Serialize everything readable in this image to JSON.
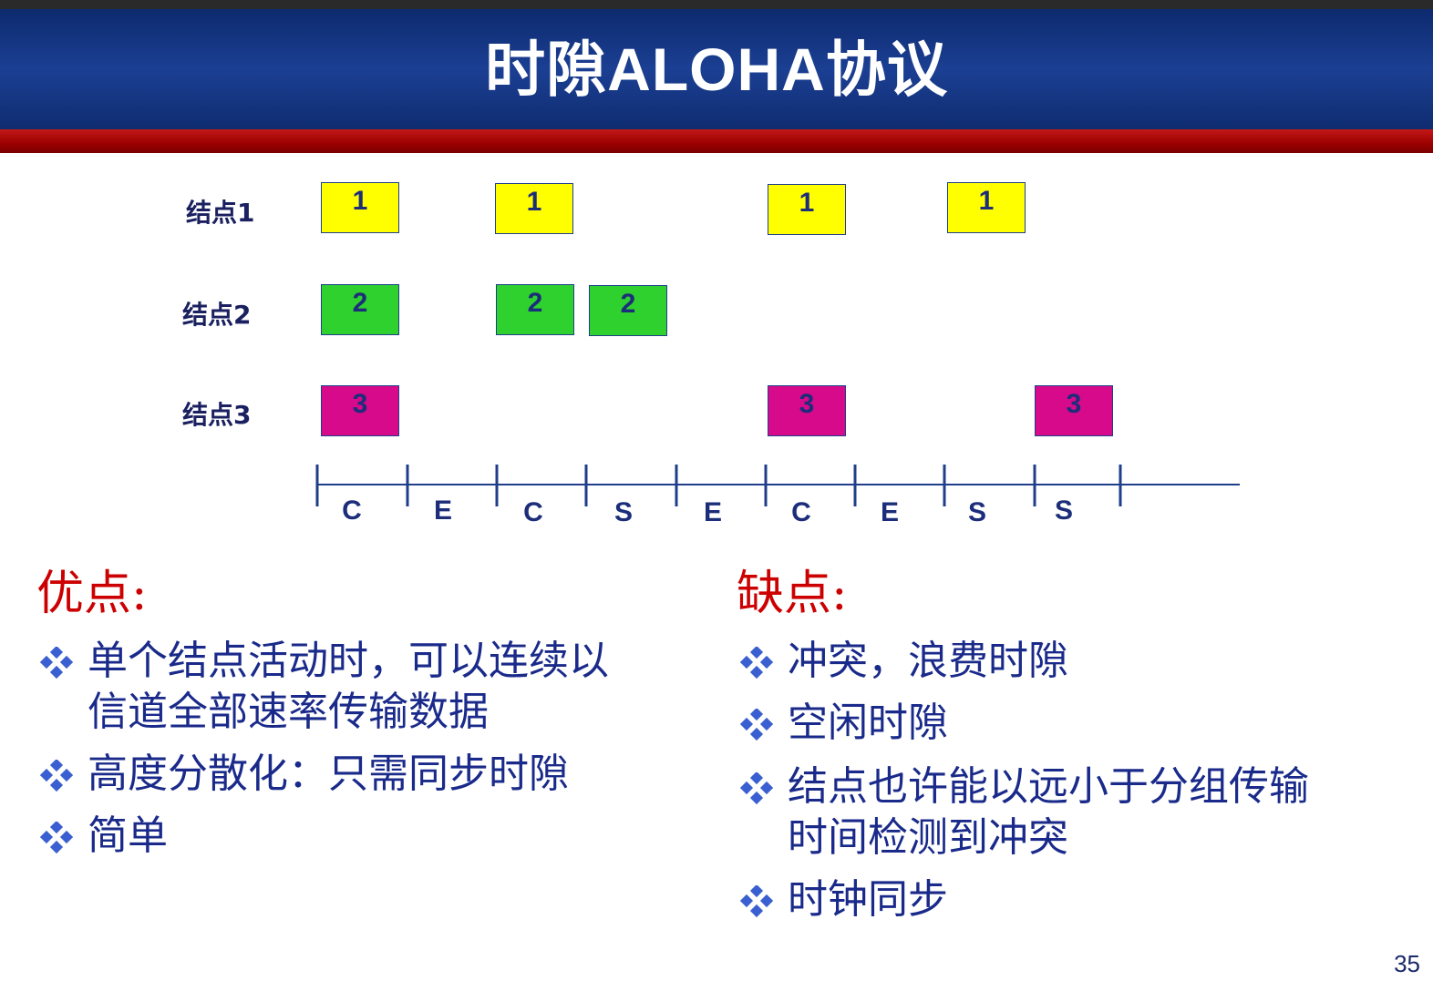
{
  "title": "时隙ALOHA协议",
  "nodes": [
    {
      "label": "结点1",
      "slots": [
        "1",
        "1",
        "1",
        "1"
      ]
    },
    {
      "label": "结点2",
      "slots": [
        "2",
        "2",
        "2"
      ]
    },
    {
      "label": "结点3",
      "slots": [
        "3",
        "3",
        "3"
      ]
    }
  ],
  "timeline": [
    "C",
    "E",
    "C",
    "S",
    "E",
    "C",
    "E",
    "S",
    "S"
  ],
  "pros": {
    "heading": "优点:",
    "items": [
      [
        "单个结点活动时，可以连续以",
        "信道全部速率传输数据"
      ],
      [
        "高度分散化：只需同步时隙"
      ],
      [
        "简单"
      ]
    ]
  },
  "cons": {
    "heading": "缺点:",
    "items": [
      [
        "冲突，浪费时隙"
      ],
      [
        "空闲时隙"
      ],
      [
        "结点也许能以远小于分组传输",
        "时间检测到冲突"
      ],
      [
        "时钟同步"
      ]
    ]
  },
  "page_number": "35",
  "colors": {
    "node1": "#ffff00",
    "node2": "#2ed12e",
    "node3": "#d60a8a",
    "heading": "#cc0000",
    "bullet_text": "#1a2a8a",
    "header_bg": "#1b3f93",
    "red_band": "#9c0000"
  }
}
